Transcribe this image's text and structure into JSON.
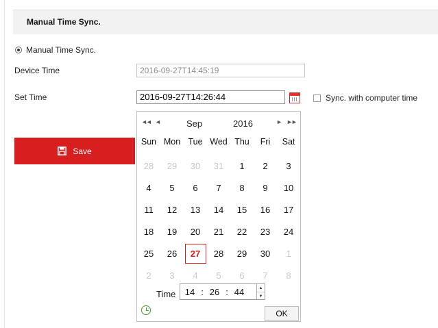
{
  "section": {
    "title": "Manual Time Sync."
  },
  "sync_mode": {
    "radio_label": "Manual Time Sync."
  },
  "device_time": {
    "label": "Device Time",
    "value": "2016-09-27T14:45:19"
  },
  "set_time": {
    "label": "Set Time",
    "value": "2016-09-27T14:26:44"
  },
  "sync_computer": {
    "label": "Sync. with computer time",
    "checked": false
  },
  "save_button": {
    "label": "Save"
  },
  "calendar": {
    "nav": {
      "prev_year": "◄◄",
      "prev_month": "◄",
      "next_month": "►",
      "next_year": "►►"
    },
    "month": "Sep",
    "year": "2016",
    "weekdays": [
      "Sun",
      "Mon",
      "Tue",
      "Wed",
      "Thu",
      "Fri",
      "Sat"
    ],
    "days": [
      {
        "d": "28",
        "other": true
      },
      {
        "d": "29",
        "other": true
      },
      {
        "d": "30",
        "other": true
      },
      {
        "d": "31",
        "other": true
      },
      {
        "d": "1"
      },
      {
        "d": "2"
      },
      {
        "d": "3"
      },
      {
        "d": "4"
      },
      {
        "d": "5"
      },
      {
        "d": "6"
      },
      {
        "d": "7"
      },
      {
        "d": "8"
      },
      {
        "d": "9"
      },
      {
        "d": "10"
      },
      {
        "d": "11"
      },
      {
        "d": "12"
      },
      {
        "d": "13"
      },
      {
        "d": "14"
      },
      {
        "d": "15"
      },
      {
        "d": "16"
      },
      {
        "d": "17"
      },
      {
        "d": "18"
      },
      {
        "d": "19"
      },
      {
        "d": "20"
      },
      {
        "d": "21"
      },
      {
        "d": "22"
      },
      {
        "d": "23"
      },
      {
        "d": "24"
      },
      {
        "d": "25"
      },
      {
        "d": "26"
      },
      {
        "d": "27",
        "selected": true
      },
      {
        "d": "28"
      },
      {
        "d": "29"
      },
      {
        "d": "30"
      },
      {
        "d": "1",
        "other": true
      },
      {
        "d": "2",
        "other": true
      },
      {
        "d": "3",
        "other": true
      },
      {
        "d": "4",
        "other": true
      },
      {
        "d": "5",
        "other": true
      },
      {
        "d": "6",
        "other": true
      },
      {
        "d": "7",
        "other": true
      },
      {
        "d": "8",
        "other": true
      }
    ],
    "time_label": "Time",
    "time": {
      "hour": "14",
      "minute": "26",
      "second": "44",
      "sep": ":"
    },
    "ok_label": "OK",
    "icons": {
      "now": "clock-refresh-icon"
    }
  },
  "colors": {
    "accent": "#d81f1f",
    "header_bg": "#f2f2f2"
  }
}
